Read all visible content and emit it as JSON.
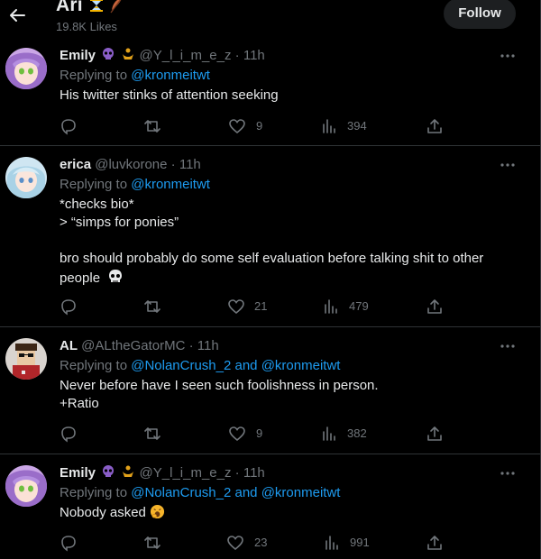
{
  "header": {
    "title": "Ari",
    "likes": "19.8K Likes",
    "follow_label": "Follow"
  },
  "icons": {
    "back": "arrow-left-icon",
    "more": "ellipsis-icon",
    "reply": "reply-bubble-icon",
    "retweet": "retweet-icon",
    "like": "heart-icon",
    "views": "bar-chart-icon",
    "share": "share-icon"
  },
  "colors": {
    "background": "#000000",
    "text": "#e7e9ea",
    "muted": "#71767b",
    "link": "#1d9bf0",
    "divider": "#2f3336"
  },
  "tweets": [
    {
      "name": "Emily",
      "handle": "@Y_l_i_m_e_z",
      "time": "· 11h",
      "replying_label": "Replying to",
      "mentions": "@kronmeitwt",
      "lines": [
        "His twitter stinks of attention seeking"
      ],
      "likes": "9",
      "views": "394"
    },
    {
      "name": "erica",
      "handle": "@luvkorone",
      "time": "· 11h",
      "replying_label": "Replying to",
      "mentions": "@kronmeitwt",
      "lines": [
        "*checks bio*",
        "> “simps for ponies”",
        "bro should probably do some self evaluation before talking shit to other",
        "people"
      ],
      "likes": "21",
      "views": "479"
    },
    {
      "name": "AL",
      "handle": "@ALtheGatorMC",
      "time": "· 11h",
      "replying_label": "Replying to",
      "mentions": "@NolanCrush_2 and @kronmeitwt",
      "lines": [
        "Never before have I seen such foolishness in person.",
        "+Ratio"
      ],
      "likes": "9",
      "views": "382"
    },
    {
      "name": "Emily",
      "handle": "@Y_l_i_m_e_z",
      "time": "· 11h",
      "replying_label": "Replying to",
      "mentions": "@NolanCrush_2 and @kronmeitwt",
      "lines": [
        "Nobody asked"
      ],
      "likes": "23",
      "views": "991"
    }
  ]
}
